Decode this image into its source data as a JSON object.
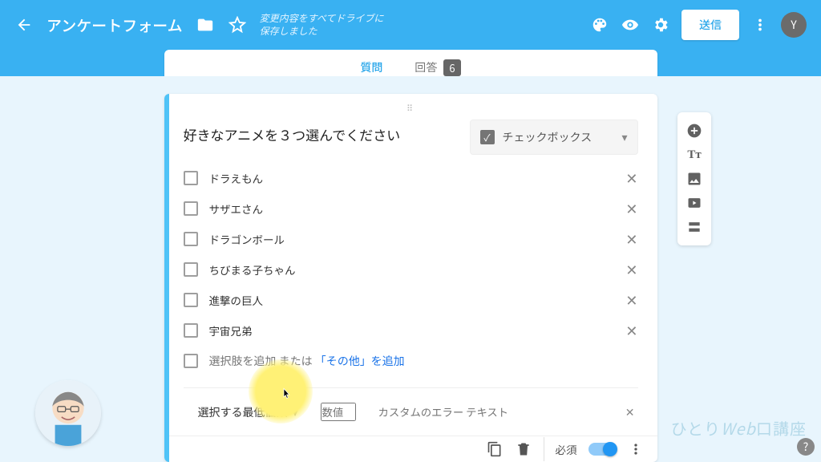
{
  "header": {
    "title": "アンケートフォーム",
    "saved_line1": "変更内容をすべてドライブに",
    "saved_line2": "保存しました",
    "send_label": "送信",
    "avatar_initial": "Y"
  },
  "tabs": {
    "questions": "質問",
    "responses": "回答",
    "response_count": "6"
  },
  "question": {
    "title": "好きなアニメを３つ選んでください",
    "type_label": "チェックボックス",
    "options": [
      "ドラえもん",
      "サザエさん",
      "ドラゴンボール",
      "ちびまる子ちゃん",
      "進撃の巨人",
      "宇宙兄弟"
    ],
    "add_option_text": "選択肢を追加",
    "or_text": " または ",
    "add_other_text": "「その他」を追加"
  },
  "validation": {
    "type_label": "選択する最低個数",
    "number_placeholder": "数値",
    "error_placeholder": "カスタムのエラー テキスト"
  },
  "footer": {
    "required_label": "必須"
  },
  "watermark": {
    "text1": "ひとり",
    "text2": "Web",
    "text3": "口講座"
  },
  "colors": {
    "accent": "#39b1f2"
  }
}
